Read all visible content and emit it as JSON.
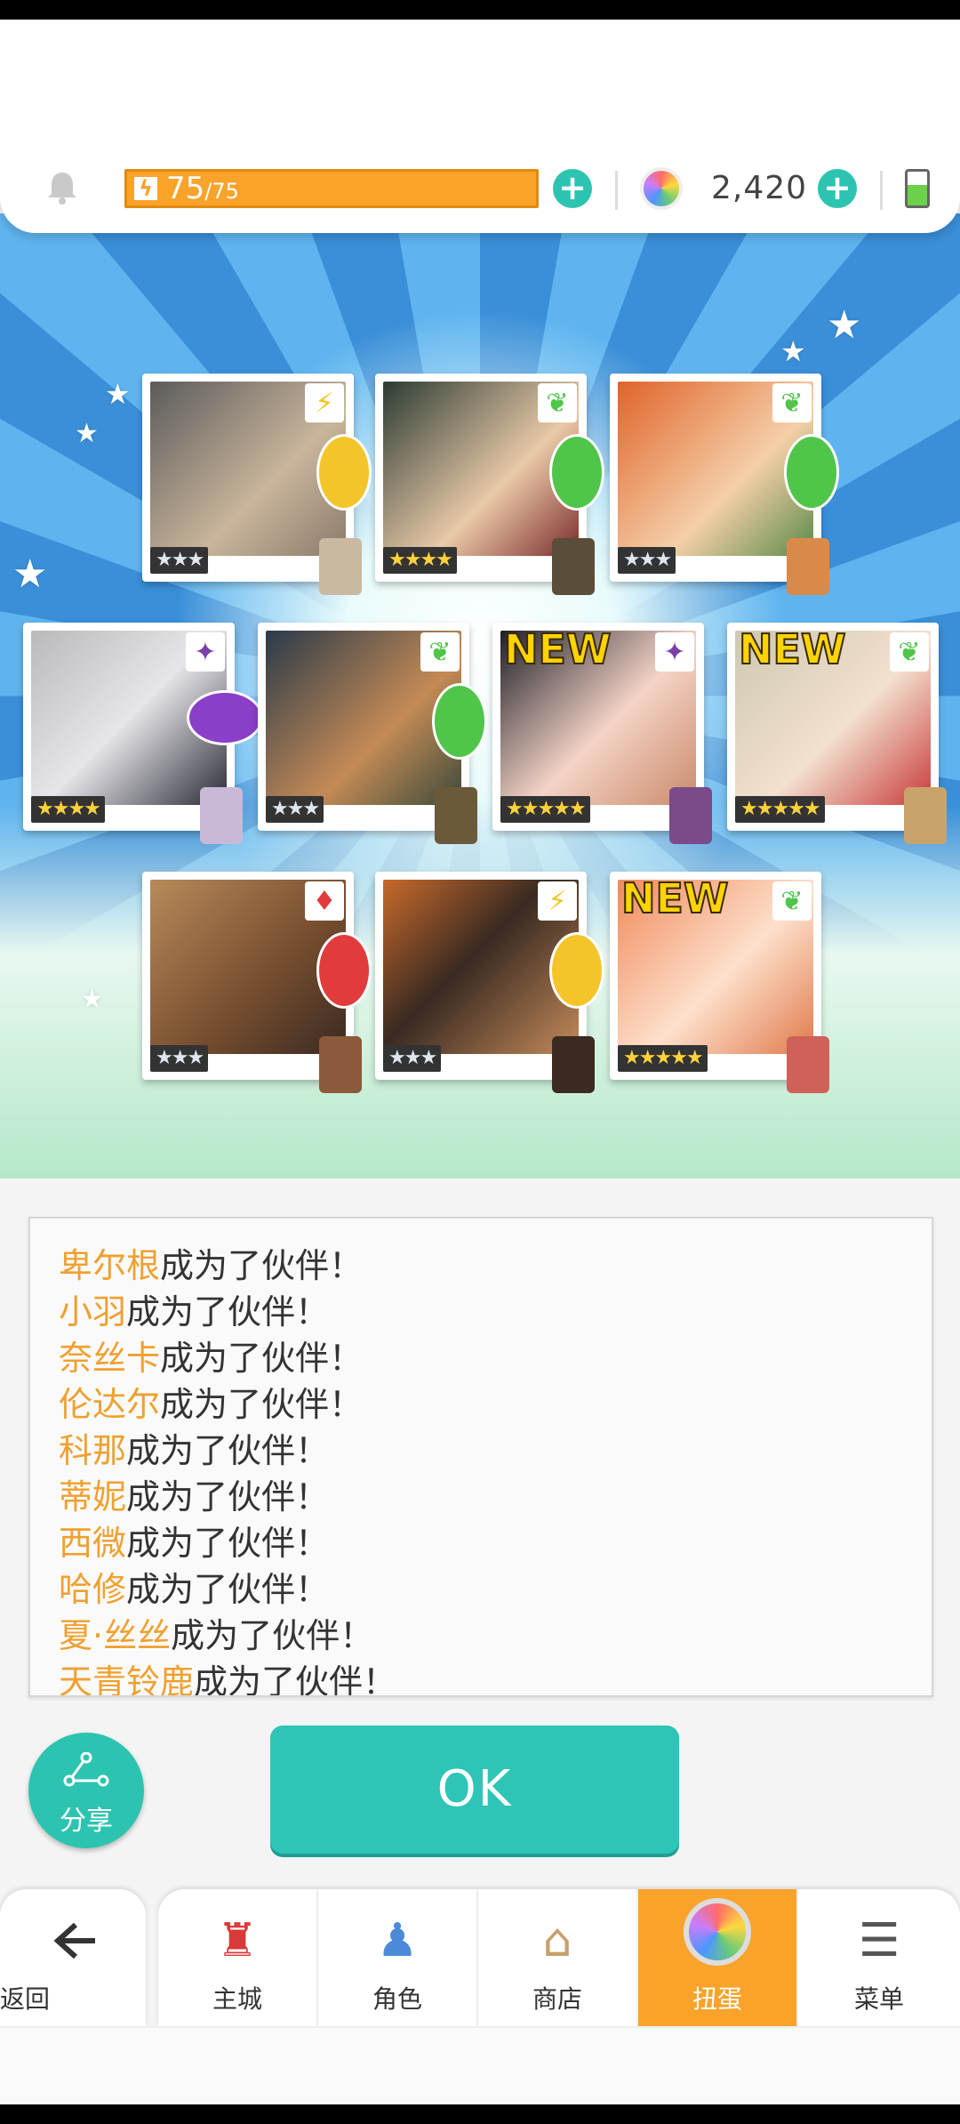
{
  "header": {
    "stamina_current": "75",
    "stamina_max": "/75",
    "gem_count": "2,420"
  },
  "colors": {
    "accent": "#2cc4b0",
    "orange": "#f9a32b",
    "name_orange": "#f0a030"
  },
  "cards": [
    {
      "elem": "⚡",
      "elem_color": "#f7c21a",
      "new": false,
      "rarity": "★★★",
      "gold": false
    },
    {
      "elem": "❦",
      "elem_color": "#4fc54a",
      "new": false,
      "rarity": "★★★★",
      "gold": true
    },
    {
      "elem": "❦",
      "elem_color": "#4fc54a",
      "new": false,
      "rarity": "★★★",
      "gold": false
    },
    {
      "elem": "✦",
      "elem_color": "#7a3fa8",
      "new": false,
      "rarity": "★★★★",
      "gold": true
    },
    {
      "elem": "❦",
      "elem_color": "#4fc54a",
      "new": false,
      "rarity": "★★★",
      "gold": false
    },
    {
      "elem": "✦",
      "elem_color": "#7a3fa8",
      "new": true,
      "rarity": "★★★★★",
      "gold": true
    },
    {
      "elem": "❦",
      "elem_color": "#4fc54a",
      "new": true,
      "rarity": "★★★★★",
      "gold": true
    },
    {
      "elem": "♦",
      "elem_color": "#e23b3b",
      "new": false,
      "rarity": "★★★",
      "gold": false
    },
    {
      "elem": "⚡",
      "elem_color": "#f7c21a",
      "new": false,
      "rarity": "★★★",
      "gold": false
    },
    {
      "elem": "❦",
      "elem_color": "#4fc54a",
      "new": true,
      "rarity": "★★★★★",
      "gold": true
    }
  ],
  "new_label": "NEW",
  "log": {
    "suffix": "成为了伙伴！",
    "lines": [
      {
        "name": "卑尔根"
      },
      {
        "name": "小羽"
      },
      {
        "name": "奈丝卡"
      },
      {
        "name": "伦达尔"
      },
      {
        "name": "科那"
      },
      {
        "name": "蒂妮"
      },
      {
        "name": "西微"
      },
      {
        "name": "哈修"
      },
      {
        "name": "夏·丝丝"
      },
      {
        "name": "天青铃鹿"
      }
    ]
  },
  "buttons": {
    "share": "分享",
    "ok": "OK"
  },
  "nav": {
    "back": "返回",
    "items": [
      {
        "label": "主城",
        "icon": "castle-icon"
      },
      {
        "label": "角色",
        "icon": "character-icon"
      },
      {
        "label": "商店",
        "icon": "shop-icon"
      },
      {
        "label": "扭蛋",
        "icon": "gacha-icon",
        "active": true
      },
      {
        "label": "菜单",
        "icon": "menu-icon"
      }
    ]
  }
}
